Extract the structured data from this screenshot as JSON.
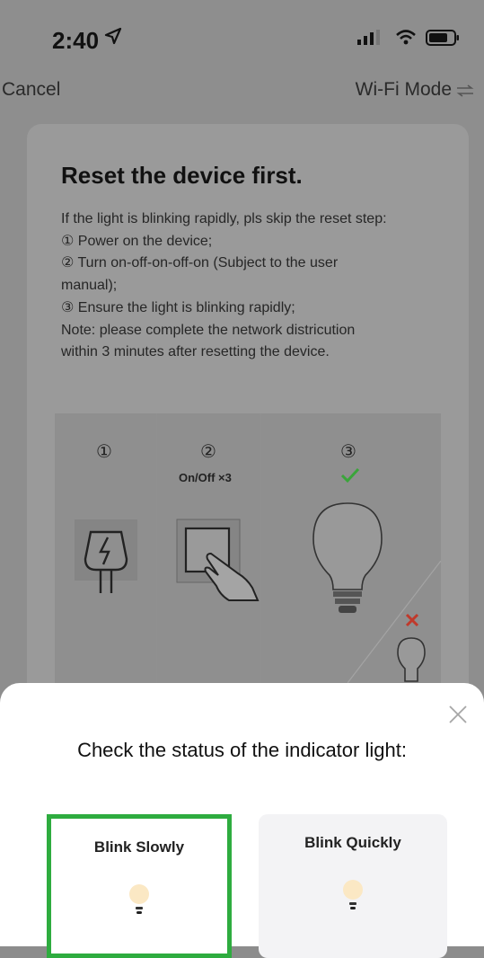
{
  "status_bar": {
    "time": "2:40",
    "icons": [
      "location-arrow-icon",
      "signal-icon",
      "wifi-icon",
      "battery-icon"
    ]
  },
  "nav": {
    "cancel_label": "Cancel",
    "mode_label": "Wi-Fi Mode",
    "mode_icon": "swap-icon"
  },
  "card": {
    "title": "Reset the device first.",
    "lines": [
      "If the light is blinking rapidly, pls skip the reset step:",
      "① Power on the device;",
      "② Turn on-off-on-off-on (Subject to the user",
      "manual);",
      "③ Ensure the light is blinking rapidly;",
      "Note: please complete the network districution",
      "within 3 minutes after resetting the device."
    ]
  },
  "illustration": {
    "steps": [
      {
        "num": "①",
        "icon": "power-plug-icon"
      },
      {
        "num": "②",
        "caption": "On/Off ×3",
        "icon": "switch-press-icon"
      },
      {
        "num": "③",
        "icon": "light-bulb-icon"
      }
    ]
  },
  "sheet": {
    "title": "Check the status of the indicator light:",
    "options": [
      {
        "label": "Blink Slowly",
        "selected": true
      },
      {
        "label": "Blink Quickly",
        "selected": false
      }
    ]
  },
  "colors": {
    "selected_border": "#2eac3f",
    "check_green": "#3aa53a",
    "x_red": "#c0392b"
  }
}
